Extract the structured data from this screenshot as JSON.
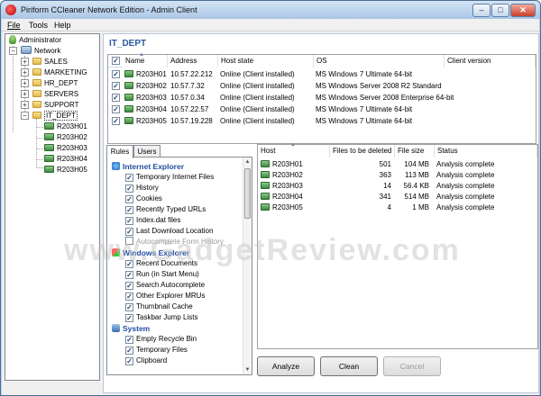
{
  "window": {
    "title": "Piriform CCleaner Network Edition - Admin Client",
    "minimize": "–",
    "maximize": "□",
    "close": "✕"
  },
  "menu": {
    "file": "File",
    "tools": "Tools",
    "help": "Help"
  },
  "tree": {
    "root": "Administrator",
    "network": "Network",
    "groups": [
      "SALES",
      "MARKETING",
      "HR_DEPT",
      "SERVERS",
      "SUPPORT",
      "IT_DEPT"
    ],
    "machines": [
      "R203H01",
      "R203H02",
      "R203H03",
      "R203H04",
      "R203H05"
    ]
  },
  "group_title": "IT_DEPT",
  "clients": {
    "columns": [
      "Name",
      "Address",
      "Host state",
      "OS",
      "Client version"
    ],
    "rows": [
      {
        "name": "R203H01",
        "address": "10.57.22.212",
        "state": "Online (Client installed)",
        "os": "MS Windows 7 Ultimate 64-bit",
        "version": ""
      },
      {
        "name": "R203H02",
        "address": "10.57.7.32",
        "state": "Online (Client installed)",
        "os": "MS Windows Server 2008 R2 Standard",
        "version": ""
      },
      {
        "name": "R203H03",
        "address": "10.57.0.34",
        "state": "Online (Client installed)",
        "os": "MS Windows Server 2008 Enterprise 64-bit",
        "version": ""
      },
      {
        "name": "R203H04",
        "address": "10.57.22.57",
        "state": "Online (Client installed)",
        "os": "MS Windows 7 Ultimate 64-bit",
        "version": ""
      },
      {
        "name": "R203H05",
        "address": "10.57.19.228",
        "state": "Online (Client installed)",
        "os": "MS Windows 7 Ultimate 64-bit",
        "version": ""
      }
    ]
  },
  "tabs": {
    "rules": "Rules",
    "users": "Users"
  },
  "rules": {
    "ie": {
      "label": "Internet Explorer",
      "items": [
        "Temporary Internet Files",
        "History",
        "Cookies",
        "Recently Typed URLs",
        "Index.dat files",
        "Last Download Location",
        "Autocomplete Form History"
      ]
    },
    "explorer": {
      "label": "Windows Explorer",
      "items": [
        "Recent Documents",
        "Run (in Start Menu)",
        "Search Autocomplete",
        "Other Explorer MRUs",
        "Thumbnail Cache",
        "Taskbar Jump Lists"
      ]
    },
    "system": {
      "label": "System",
      "items": [
        "Empty Recycle Bin",
        "Temporary Files",
        "Clipboard"
      ]
    }
  },
  "results": {
    "columns": [
      "Host",
      "Files to be deleted",
      "File size",
      "Status"
    ],
    "rows": [
      {
        "host": "R203H01",
        "files": "501",
        "size": "104 MB",
        "status": "Analysis complete"
      },
      {
        "host": "R203H02",
        "files": "363",
        "size": "113 MB",
        "status": "Analysis complete"
      },
      {
        "host": "R203H03",
        "files": "14",
        "size": "56.4 KB",
        "status": "Analysis complete"
      },
      {
        "host": "R203H04",
        "files": "341",
        "size": "514 MB",
        "status": "Analysis complete"
      },
      {
        "host": "R203H05",
        "files": "4",
        "size": "1 MB",
        "status": "Analysis complete"
      }
    ]
  },
  "buttons": {
    "analyze": "Analyze",
    "clean": "Clean",
    "cancel": "Cancel"
  },
  "watermark": "www.GadgetReview.com",
  "colors": {
    "accent": "#1e4ea0",
    "group_title": "#2b5aa0",
    "titlebar": "#bcd4ec"
  }
}
